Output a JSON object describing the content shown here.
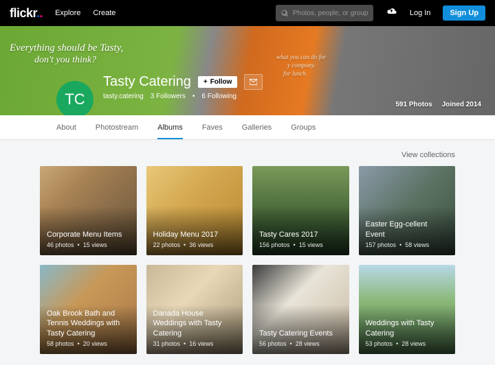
{
  "topbar": {
    "logo": "flickr",
    "explore": "Explore",
    "create": "Create",
    "search_placeholder": "Photos, people, or groups",
    "login": "Log In",
    "signup": "Sign Up"
  },
  "cover": {
    "van_text_1": "Everything should be Tasty,",
    "van_text_2": "don't you think?",
    "van_text_3": "what you can do for",
    "van_text_4": "y company.",
    "van_text_5": "for lunch."
  },
  "profile": {
    "avatar_initials": "TC",
    "name": "Tasty Catering",
    "follow_label": "Follow",
    "username": "tasty.catering",
    "followers": "3 Followers",
    "following": "6 Following",
    "photos": "591 Photos",
    "joined": "Joined 2014"
  },
  "tabs": [
    "About",
    "Photostream",
    "Albums",
    "Faves",
    "Galleries",
    "Groups"
  ],
  "active_tab": 2,
  "view_collections": "View collections",
  "albums": [
    {
      "title": "Corporate Menu Items",
      "photos": "46 photos",
      "views": "15 views"
    },
    {
      "title": "Holiday Menu 2017",
      "photos": "22 photos",
      "views": "36 views"
    },
    {
      "title": "Tasty Cares 2017",
      "photos": "156 photos",
      "views": "15 views"
    },
    {
      "title": "Easter Egg-cellent Event",
      "photos": "157 photos",
      "views": "58 views"
    },
    {
      "title": "Oak Brook Bath and Tennis Weddings with Tasty Catering",
      "photos": "58 photos",
      "views": "20 views"
    },
    {
      "title": "Danada House Weddings with Tasty Catering",
      "photos": "31 photos",
      "views": "16 views"
    },
    {
      "title": "Tasty Catering Events",
      "photos": "56 photos",
      "views": "28 views"
    },
    {
      "title": "Weddings with Tasty Catering",
      "photos": "53 photos",
      "views": "28 views"
    }
  ]
}
